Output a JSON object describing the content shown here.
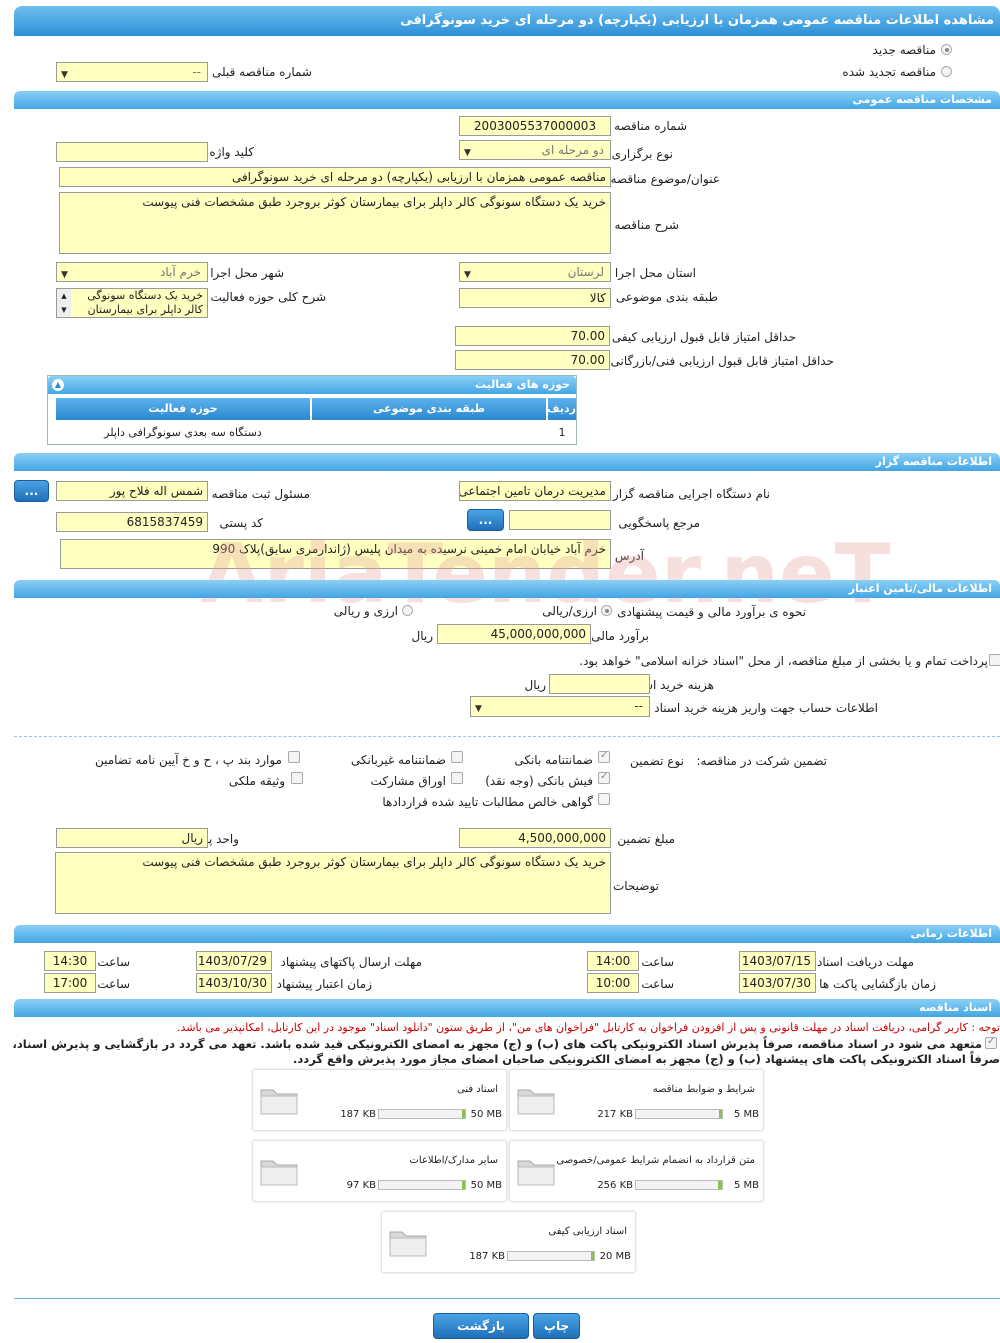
{
  "page": {
    "title": "مشاهده اطلاعات مناقصه عمومی همزمان با ارزیابی (یکپارچه) دو مرحله ای خرید سونوگرافی"
  },
  "top": {
    "new_tender": "مناقصه جدید",
    "renewed_tender": "مناقصه تجدید شده",
    "prev_tender_label": "شماره مناقصه قبلی",
    "prev_tender_value": "--"
  },
  "sections": {
    "general": "مشخصات مناقصه عمومی",
    "organizer": "اطلاعات مناقصه گزار",
    "finance": "اطلاعات مالی/تامین اعتبار",
    "timing": "اطلاعات زمانی",
    "docs": "اسناد مناقصه"
  },
  "general": {
    "tender_no_label": "شماره مناقصه",
    "tender_no": "2003005537000003",
    "type_label": "نوع برگزاری",
    "type_value": "دو مرحله ای",
    "keyword_label": "کلید واژه",
    "keyword_value": "",
    "subject_label": "عنوان/موضوع مناقصه",
    "subject_value": "مناقصه عمومی همزمان با ارزیابی (یکپارچه) دو مرحله ای خرید سونوگرافی",
    "desc_label": "شرح مناقصه",
    "desc_value": "خرید یک دستگاه سونوگی کالر داپلر برای بیمارستان کوثر بروجرد طبق مشخصات  فنی پیوست",
    "province_label": "استان محل اجرا",
    "province_value": "لرستان",
    "city_label": "شهر محل اجرا",
    "city_value": "خرم آباد",
    "category_label": "طبقه بندی موضوعی",
    "category_value": "کالا",
    "activity_label": "شرح کلی حوزه فعالیت",
    "activity_value": "خرید یک دستگاه سونوگی کالر داپلر برای بیمارستان",
    "min_quality_label": "حداقل امتیاز قابل قبول ارزیابی کیفی",
    "min_quality": "70.00",
    "min_tech_label": "حداقل امتیاز قابل قبول ارزیابی فنی/بازرگانی",
    "min_tech": "70.00"
  },
  "activity_table": {
    "title": "حوزه های فعالیت",
    "headers": [
      "ردیف",
      "طبقه بندی موضوعی",
      "حوزه فعالیت"
    ],
    "rows": [
      [
        "1",
        "",
        "دستگاه سه بعدی سونوگرافی داپلر"
      ]
    ]
  },
  "organizer": {
    "org_label": "نام دستگاه اجرایی مناقصه گزار",
    "org_value": "مدیریت درمان تامین اجتماعی",
    "registrar_label": "مسئول ثبت مناقصه",
    "registrar_value": "شمس اله فلاح پور",
    "ref_label": "مرجع پاسخگویی",
    "ref_value": "",
    "postal_label": "کد پستی",
    "postal_value": "6815837459",
    "address_label": "آدرس",
    "address_value": "خرم آباد خیابان امام خمینی نرسیده به میدان پلیس (ژاندارمری سابق)پلاک 990",
    "more_button": "..."
  },
  "finance": {
    "estimate_method_label": "نحوه ی برآورد مالی و قیمت پیشنهادی",
    "opt1": "ارزی/ریالی",
    "opt2": "ارزی و ریالی",
    "estimate_label": "برآورد مالی",
    "estimate_value": "45,000,000,000",
    "currency": "ریال",
    "treasury_text": "پرداخت تمام و یا بخشی از مبلغ مناقصه، از محل \"اسناد خزانه اسلامی\" خواهد بود.",
    "doc_fee_label": "هزینه خرید اسناد",
    "doc_fee_value": "",
    "doc_fee_currency": "ریال",
    "account_label": "اطلاعات حساب جهت واریز هزینه خرید اسناد",
    "account_value": "--"
  },
  "guarantee": {
    "title": "تضمین شرکت در مناقصه:",
    "type_label": "نوع تضمین",
    "opts": [
      "ضمانتنامه بانکی",
      "ضمانتنامه غیربانکی",
      "موارد بند پ ، ح و خ آیین نامه تضامین",
      "فیش بانکی (وجه نقد)",
      "اوراق مشارکت",
      "وثیقه ملکی",
      "گواهی خالص مطالبات تایید شده قراردادها"
    ],
    "amount_label": "مبلغ تضمین",
    "amount_value": "4,500,000,000",
    "unit_label": "واحد پول",
    "unit_value": "ریال",
    "notes_label": "توضیحات",
    "notes_value": "خرید یک دستگاه سونوگی کالر داپلر برای بیمارستان کوثر بروجرد طبق مشخصات  فنی پیوست"
  },
  "timing": {
    "receive_label": "مهلت دریافت اسناد",
    "receive_date": "1403/07/15",
    "receive_time": "14:00",
    "send_label": "مهلت ارسال پاکتهای پیشنهاد",
    "send_date": "1403/07/29",
    "send_time": "14:30",
    "open_label": "زمان بازگشایی پاکت ها",
    "open_date": "1403/07/30",
    "open_time": "10:00",
    "validity_label": "زمان اعتبار پیشنهاد",
    "validity_date": "1403/10/30",
    "validity_time": "17:00",
    "time_label": "ساعت"
  },
  "docs": {
    "note_red": "توجه : کاربر گرامی، دریافت اسناد در مهلت قانونی و پس از افزودن فراخوان به کارتابل \"فراخوان های من\"، از طریق ستون \"دانلود اسناد\" موجود در این کارتابل، امکانپذیر می باشد.",
    "note_bold1": "متعهد می شود در اسناد مناقصه، صرفاً پذیرش اسناد الکترونیکی پاکت های (ب) و (ج) مجهز به امضای الکترونیکی قید شده باشد. تعهد می گردد در بازگشایی و پذیرش اسناد،",
    "note_bold2": "صرفاً اسناد الکترونیکی پاکت های پیشنهاد (ب) و (ج) مجهز به امضای الکترونیکی صاحبان امضای مجاز مورد پذیرش واقع گردد.",
    "files": [
      {
        "name": "شرایط و ضوابط مناقصه",
        "size": "217 KB",
        "max": "5 MB",
        "pct": 0.04
      },
      {
        "name": "اسناد فنی",
        "size": "187 KB",
        "max": "50 MB",
        "pct": 0.004
      },
      {
        "name": "متن قرارداد به انضمام شرایط عمومی/خصوصی",
        "size": "256 KB",
        "max": "5 MB",
        "pct": 0.05
      },
      {
        "name": "سایر مدارک/اطلاعات",
        "size": "97 KB",
        "max": "50 MB",
        "pct": 0.002
      },
      {
        "name": "اسناد ارزیابی کیفی",
        "size": "187 KB",
        "max": "20 MB",
        "pct": 0.009
      }
    ]
  },
  "buttons": {
    "print": "چاپ",
    "back": "بازگشت"
  },
  "watermark": "AriaTender.neT"
}
